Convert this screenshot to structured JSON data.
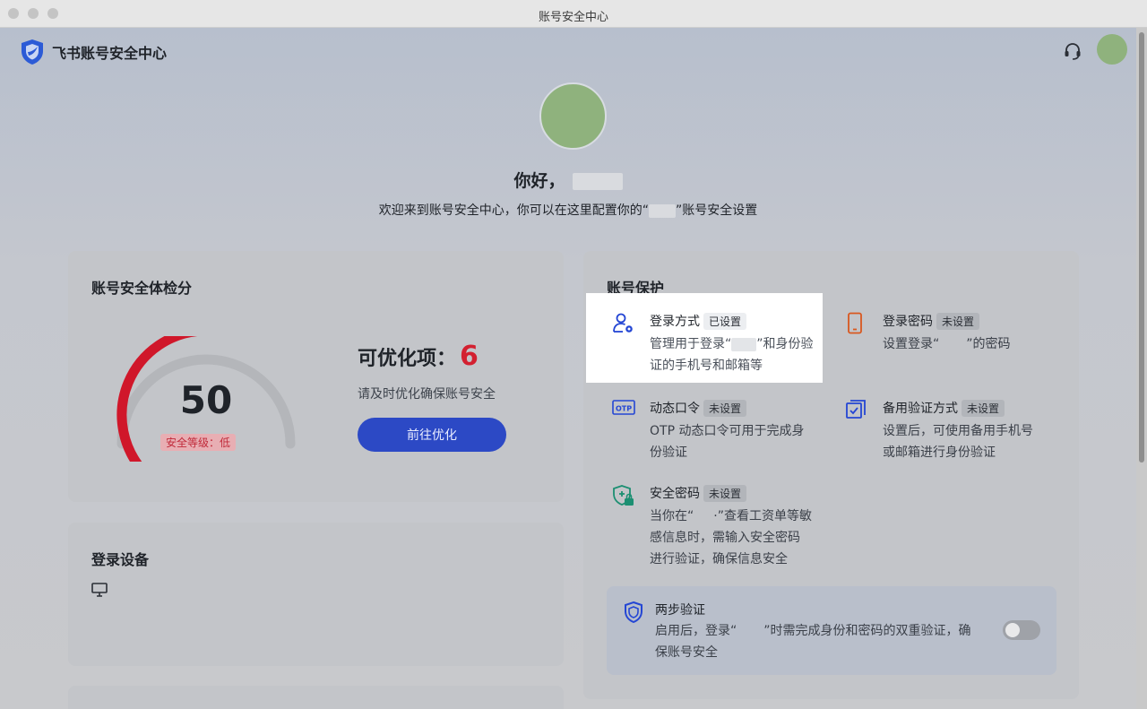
{
  "window": {
    "title": "账号安全中心"
  },
  "header": {
    "brand": "飞书账号安全中心",
    "icons": [
      "shield-logo-icon",
      "headset-icon"
    ]
  },
  "hero": {
    "greeting": "你好，",
    "welcome_prefix": "欢迎来到账号安全中心，你可以在这里配置你的“",
    "welcome_suffix": "”账号安全设置"
  },
  "score_card": {
    "title": "账号安全体检分",
    "score": "50",
    "score_value": 50,
    "score_max": 100,
    "level": "安全等级：低",
    "optimize_label": "可优化项：",
    "optimize_count": "6",
    "optimize_hint": "请及时优化确保账号安全",
    "optimize_button": "前往优化",
    "colors": {
      "gauge": "#d0172a",
      "button": "#2c49c5"
    }
  },
  "devices_card": {
    "title": "登录设备",
    "icons": [
      "monitor-icon"
    ]
  },
  "protection": {
    "title": "账号保护",
    "items": [
      {
        "name": "登录方式",
        "badge": "已设置",
        "desc": [
          "管理用于登录“",
          "”和身份验",
          "证的手机号和邮箱等"
        ],
        "icon": "user-gear-icon",
        "color": "#2446d4"
      },
      {
        "name": "登录密码",
        "badge": "未设置",
        "desc": [
          "设置登录“",
          "”的密码"
        ],
        "icon": "phone-icon",
        "color": "#d9581f"
      },
      {
        "name": "动态口令",
        "badge": "未设置",
        "desc": [
          "OTP 动态口令可用于完成身",
          "份验证"
        ],
        "icon": "otp-icon",
        "icon_text": "OTP",
        "color": "#2446d4"
      },
      {
        "name": "备用验证方式",
        "badge": "未设置",
        "desc": [
          "设置后，可使用备用手机号",
          "或邮箱进行身份验证"
        ],
        "icon": "checkbox-icon",
        "color": "#2446d4"
      },
      {
        "name": "安全密码",
        "badge": "未设置",
        "desc": [
          "当你在“",
          "·”查看工资单等敏",
          "感信息时，需输入安全密码",
          "进行验证，确保信息安全"
        ],
        "icon": "shield-lock-icon",
        "color": "#1c8f72"
      }
    ],
    "two_step": {
      "title": "两步验证",
      "desc": [
        "启用后，登录“",
        "”时需完成身份和密码的双重验证，确",
        "保账号安全"
      ],
      "icon": "shield-icon",
      "enabled": false
    }
  }
}
